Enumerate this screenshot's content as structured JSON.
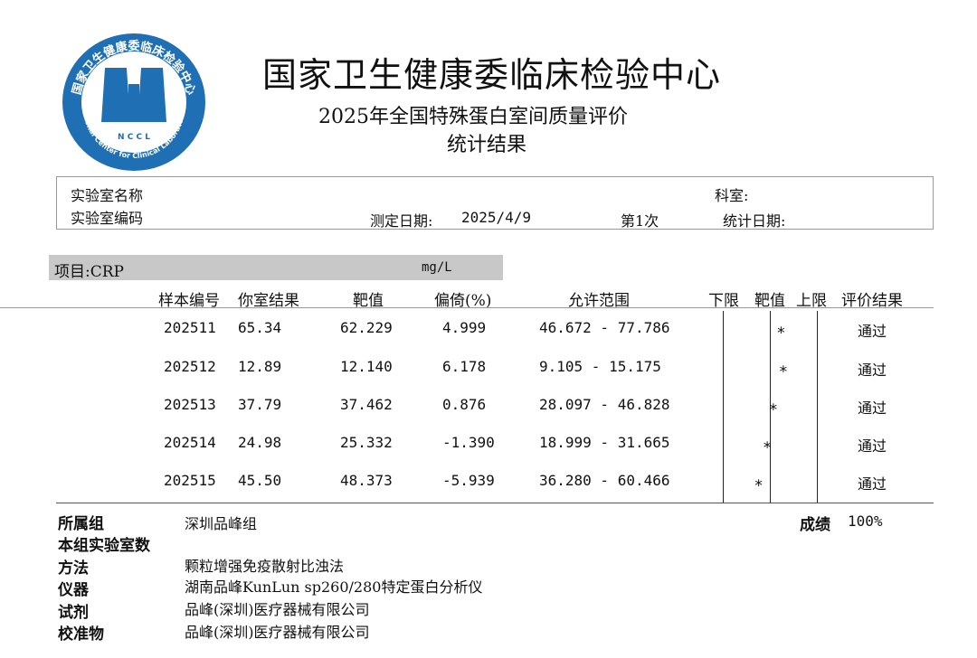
{
  "header": {
    "logo": {
      "ring_text_top": "国家卫生健康委临床检验中心",
      "ring_text_bottom": "National Center for Clinical Laboratories",
      "letters": "N C C L",
      "color": "#1f6fb5"
    },
    "org_name": "国家卫生健康委临床检验中心",
    "report_title": "2025年全国特殊蛋白室间质量评价",
    "report_subtitle": "统计结果"
  },
  "info": {
    "lab_name_label": "实验室名称",
    "lab_code_label": "实验室编码",
    "dept_label": "科室:",
    "test_date_label": "测定日期:",
    "test_date": "2025/4/9",
    "round": "第1次",
    "stat_date_label": "统计日期:"
  },
  "project": {
    "label": "项目:CRP",
    "unit": "mg/L"
  },
  "table": {
    "headers": {
      "sample_id": "样本编号",
      "your_result": "你室结果",
      "target": "靶值",
      "bias": "偏倚(%)",
      "range": "允许范围",
      "lower": "下限",
      "target2": "靶值",
      "upper": "上限",
      "evaluation": "评价结果"
    },
    "rows": [
      {
        "id": "202511",
        "result": "65.34",
        "target": "62.229",
        "bias": "4.999",
        "range": "46.672 - 77.786",
        "position": 4.999,
        "eval": "通过"
      },
      {
        "id": "202512",
        "result": "12.89",
        "target": "12.140",
        "bias": "6.178",
        "range": "9.105 - 15.175",
        "position": 6.178,
        "eval": "通过"
      },
      {
        "id": "202513",
        "result": "37.79",
        "target": "37.462",
        "bias": "0.876",
        "range": "28.097 - 46.828",
        "position": 0.876,
        "eval": "通过"
      },
      {
        "id": "202514",
        "result": "24.98",
        "target": "25.332",
        "bias": "-1.390",
        "range": "18.999 - 31.665",
        "position": -1.39,
        "eval": "通过"
      },
      {
        "id": "202515",
        "result": "45.50",
        "target": "48.373",
        "bias": "-5.939",
        "range": "36.280 - 60.466",
        "position": -5.939,
        "eval": "通过"
      }
    ],
    "marker": "⁎"
  },
  "footer": {
    "group_label": "所属组",
    "group_value": "深圳品峰组",
    "count_label": "本组实验室数",
    "method_label": "方法",
    "method_value": "颗粒增强免疫散射比浊法",
    "instrument_label": "仪器",
    "instrument_value": "湖南品峰KunLun sp260/280特定蛋白分析仪",
    "reagent_label": "试剂",
    "reagent_value": "品峰(深圳)医疗器械有限公司",
    "calibrator_label": "校准物",
    "calibrator_value": "品峰(深圳)医疗器械有限公司",
    "score_label": "成绩",
    "score_value": "100%"
  }
}
